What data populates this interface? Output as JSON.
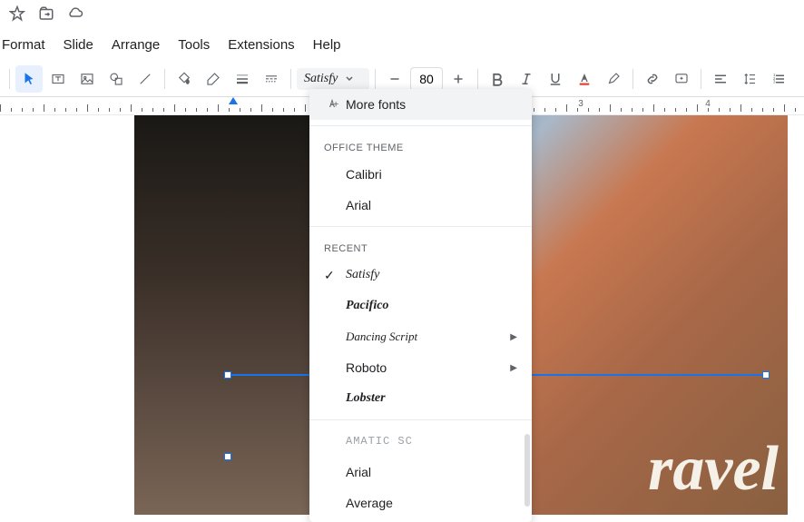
{
  "menubar": {
    "format": "Format",
    "slide": "Slide",
    "arrange": "Arrange",
    "tools": "Tools",
    "extensions": "Extensions",
    "help": "Help"
  },
  "toolbar": {
    "font_name": "Satisfy",
    "font_size": "80"
  },
  "ruler": {
    "marks": [
      "3",
      "4"
    ]
  },
  "slide": {
    "text": "ravel"
  },
  "fontmenu": {
    "more_fonts": "More fonts",
    "section_theme": "OFFICE THEME",
    "theme_fonts": [
      "Calibri",
      "Arial"
    ],
    "section_recent": "RECENT",
    "recent_fonts": [
      {
        "name": "Satisfy",
        "checked": true,
        "submenu": false,
        "style": "font-satisfy"
      },
      {
        "name": "Pacifico",
        "checked": false,
        "submenu": false,
        "style": "font-pacifico"
      },
      {
        "name": "Dancing Script",
        "checked": false,
        "submenu": true,
        "style": "font-dancing"
      },
      {
        "name": "Roboto",
        "checked": false,
        "submenu": true,
        "style": ""
      },
      {
        "name": "Lobster",
        "checked": false,
        "submenu": false,
        "style": "font-lobster"
      }
    ],
    "other_fonts": [
      {
        "name": "Amatic SC",
        "style": "font-amatic"
      },
      {
        "name": "Arial",
        "style": ""
      },
      {
        "name": "Average",
        "style": ""
      }
    ]
  }
}
